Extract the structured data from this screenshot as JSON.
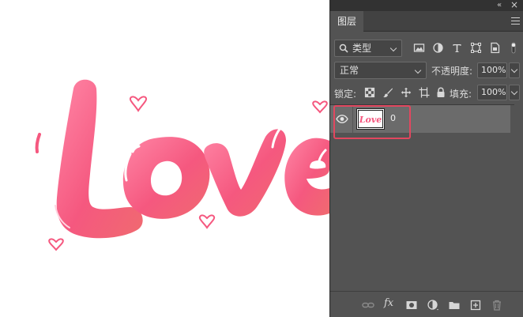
{
  "window": {
    "collapse_glyph": "«",
    "close_glyph": "×"
  },
  "panel": {
    "tab_label": "图层",
    "menu_icon": "hamburger-icon"
  },
  "filter": {
    "kind_label": "类型",
    "icons": [
      "image-filter-icon",
      "adjustment-filter-icon",
      "type-filter-icon",
      "shape-filter-icon",
      "smart-object-filter-icon",
      "filter-toggle-icon"
    ]
  },
  "blend": {
    "mode": "正常",
    "opacity_label": "不透明度:",
    "opacity_value": "100%"
  },
  "lock": {
    "label": "锁定:",
    "icons": [
      "lock-transparent-icon",
      "lock-paint-icon",
      "lock-move-icon",
      "lock-artboard-icon",
      "lock-all-icon"
    ],
    "fill_label": "填充:",
    "fill_value": "100%"
  },
  "layers": [
    {
      "name": "0",
      "visible": true,
      "selected": true,
      "thumb_text": "Love"
    }
  ],
  "bottom_icons": [
    "link-layers-icon",
    "fx-icon",
    "mask-icon",
    "adjustment-layer-icon",
    "group-folder-icon",
    "new-layer-icon",
    "trash-icon"
  ],
  "bottom_fx_label": "fx",
  "canvas": {
    "art_text": "Love",
    "colors": {
      "pink_light": "#ff7ea0",
      "pink": "#f5587f",
      "pink_dark": "#e94f76",
      "highlight": "#e2475f"
    }
  }
}
